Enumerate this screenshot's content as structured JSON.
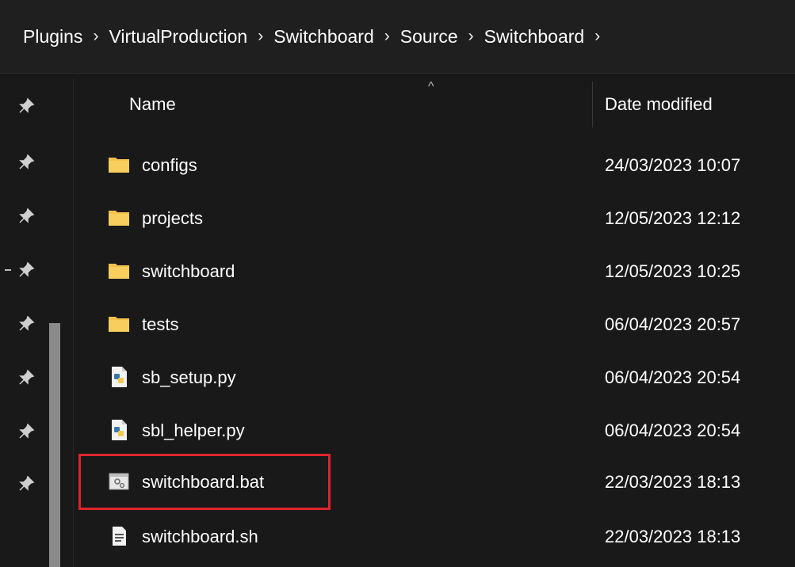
{
  "breadcrumb": {
    "items": [
      "Plugins",
      "VirtualProduction",
      "Switchboard",
      "Source",
      "Switchboard"
    ],
    "separator": "›"
  },
  "header": {
    "name_label": "Name",
    "date_label": "Date modified",
    "sort_indicator": "^"
  },
  "files": [
    {
      "name": "configs",
      "date": "24/03/2023 10:07",
      "icon": "folder-icon"
    },
    {
      "name": "projects",
      "date": "12/05/2023 12:12",
      "icon": "folder-icon"
    },
    {
      "name": "switchboard",
      "date": "12/05/2023 10:25",
      "icon": "folder-icon"
    },
    {
      "name": "tests",
      "date": "06/04/2023 20:57",
      "icon": "folder-icon"
    },
    {
      "name": "sb_setup.py",
      "date": "06/04/2023 20:54",
      "icon": "python-file-icon"
    },
    {
      "name": "sbl_helper.py",
      "date": "06/04/2023 20:54",
      "icon": "python-file-icon"
    },
    {
      "name": "switchboard.bat",
      "date": "22/03/2023 18:13",
      "icon": "batch-file-icon"
    },
    {
      "name": "switchboard.sh",
      "date": "22/03/2023 18:13",
      "icon": "text-file-icon"
    }
  ],
  "highlighted_file": "switchboard.bat",
  "colors": {
    "background": "#191919",
    "folder": "#f3c04a",
    "highlight": "#e0242c"
  }
}
